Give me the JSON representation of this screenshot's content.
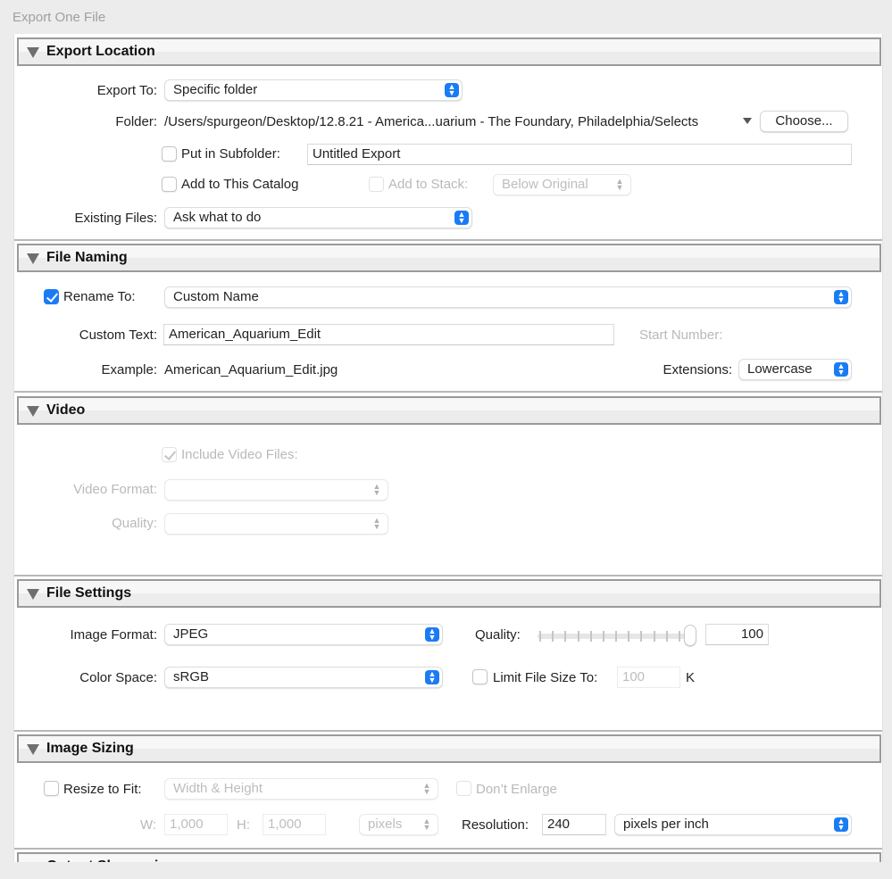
{
  "window": {
    "title": "Export One File"
  },
  "sections": {
    "export_location": {
      "title": "Export Location",
      "export_to": {
        "label": "Export To:",
        "value": "Specific folder"
      },
      "folder": {
        "label": "Folder:",
        "path": "/Users/spurgeon/Desktop/12.8.21 - America...uarium - The Foundary, Philadelphia/Selects",
        "choose_label": "Choose..."
      },
      "subfolder": {
        "label": "Put in Subfolder:",
        "checked": false,
        "value": "Untitled Export"
      },
      "add_catalog": {
        "label": "Add to This Catalog",
        "checked": false
      },
      "add_stack": {
        "label": "Add to Stack:",
        "checked": false,
        "value": "Below Original",
        "disabled": true
      },
      "existing_files": {
        "label": "Existing Files:",
        "value": "Ask what to do"
      }
    },
    "file_naming": {
      "title": "File Naming",
      "rename_to": {
        "label": "Rename To:",
        "checked": true,
        "value": "Custom Name"
      },
      "custom_text": {
        "label": "Custom Text:",
        "value": "American_Aquarium_Edit"
      },
      "start_number": {
        "label": "Start Number:",
        "disabled": true
      },
      "example": {
        "label": "Example:",
        "value": "American_Aquarium_Edit.jpg"
      },
      "extensions": {
        "label": "Extensions:",
        "value": "Lowercase"
      }
    },
    "video": {
      "title": "Video",
      "include_video": {
        "label": "Include Video Files:",
        "checked": true,
        "disabled": true
      },
      "video_format": {
        "label": "Video Format:",
        "value": "",
        "disabled": true
      },
      "quality": {
        "label": "Quality:",
        "value": "",
        "disabled": true
      }
    },
    "file_settings": {
      "title": "File Settings",
      "image_format": {
        "label": "Image Format:",
        "value": "JPEG"
      },
      "quality": {
        "label": "Quality:",
        "value": "100",
        "slider_percent": 100
      },
      "color_space": {
        "label": "Color Space:",
        "value": "sRGB"
      },
      "limit_file_size": {
        "label": "Limit File Size To:",
        "checked": false,
        "value": "100",
        "unit": "K"
      }
    },
    "image_sizing": {
      "title": "Image Sizing",
      "resize_to_fit": {
        "label": "Resize to Fit:",
        "checked": false,
        "value": "Width & Height"
      },
      "dont_enlarge": {
        "label": "Don’t Enlarge",
        "checked": false,
        "disabled": true
      },
      "width": {
        "label": "W:",
        "value": "1,000"
      },
      "height": {
        "label": "H:",
        "value": "1,000"
      },
      "units": {
        "value": "pixels"
      },
      "resolution": {
        "label": "Resolution:",
        "value": "240",
        "unit": "pixels per inch"
      }
    },
    "output_sharpening": {
      "title": "Output Sharpening"
    }
  },
  "icons": {
    "stepper": "⌃⌄",
    "disclosure": "disclosure-triangle-down"
  }
}
